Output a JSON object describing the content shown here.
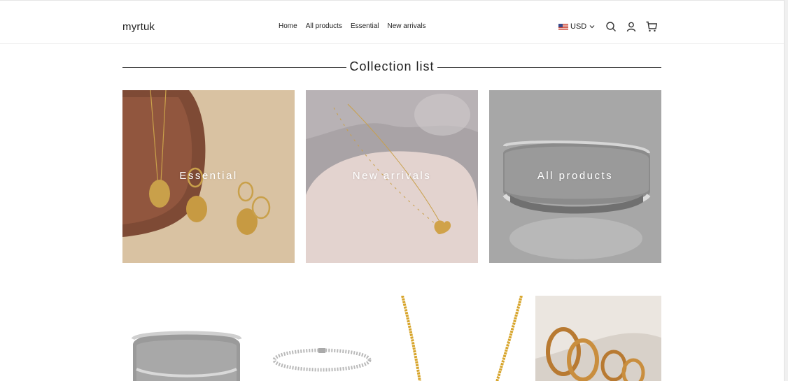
{
  "header": {
    "logo": "myrtuk",
    "nav": [
      "Home",
      "All products",
      "Essential",
      "New arrivals"
    ],
    "currency": "USD"
  },
  "section": {
    "title": "Collection list"
  },
  "collections": [
    {
      "label": "Essential"
    },
    {
      "label": "New arrivals"
    },
    {
      "label": "All products"
    }
  ],
  "icons": [
    "search-icon",
    "account-icon",
    "cart-icon",
    "chevron-down-icon",
    "us-flag-icon"
  ],
  "colors": {
    "text": "#222222",
    "divider": "#444444",
    "card_overlay_text": "#ffffff"
  }
}
